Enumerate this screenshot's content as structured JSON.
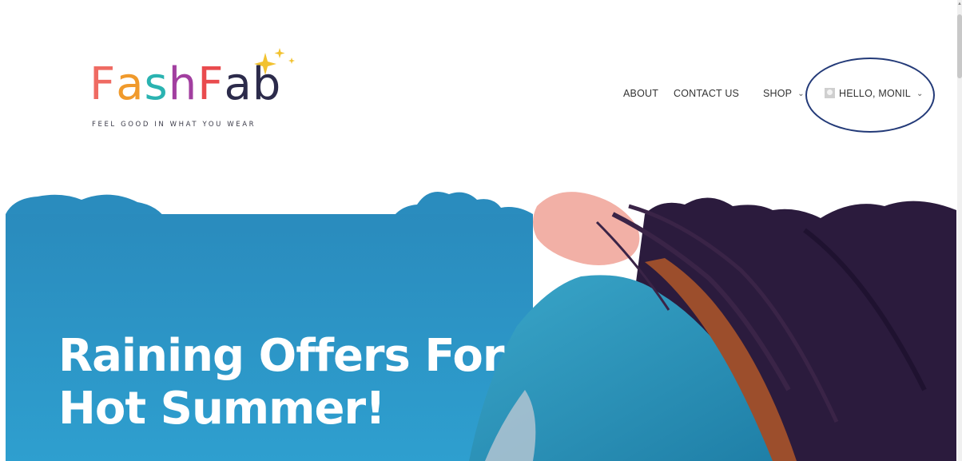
{
  "logo": {
    "letters": [
      {
        "ch": "F",
        "color": "#ef6b63"
      },
      {
        "ch": "a",
        "color": "#f09a2c"
      },
      {
        "ch": "s",
        "color": "#2ab3b1"
      },
      {
        "ch": "h",
        "color": "#a23fa0"
      },
      {
        "ch": "F",
        "color": "#e94b4e"
      },
      {
        "ch": "a",
        "color": "#2c2b4b"
      },
      {
        "ch": "b",
        "color": "#2c2b4b"
      }
    ],
    "tagline": "FEEL GOOD IN WHAT YOU WEAR",
    "sparkle_color": "#f2c230"
  },
  "nav": {
    "about": "ABOUT",
    "contact": "CONTACT US",
    "shop": "SHOP",
    "user": "HELLO, MONIL"
  },
  "hero": {
    "title_line1": "Raining Offers For",
    "title_line2": "Hot Summer!",
    "sky_color": "#2a8bbd"
  },
  "annotation_color": "#233a78"
}
